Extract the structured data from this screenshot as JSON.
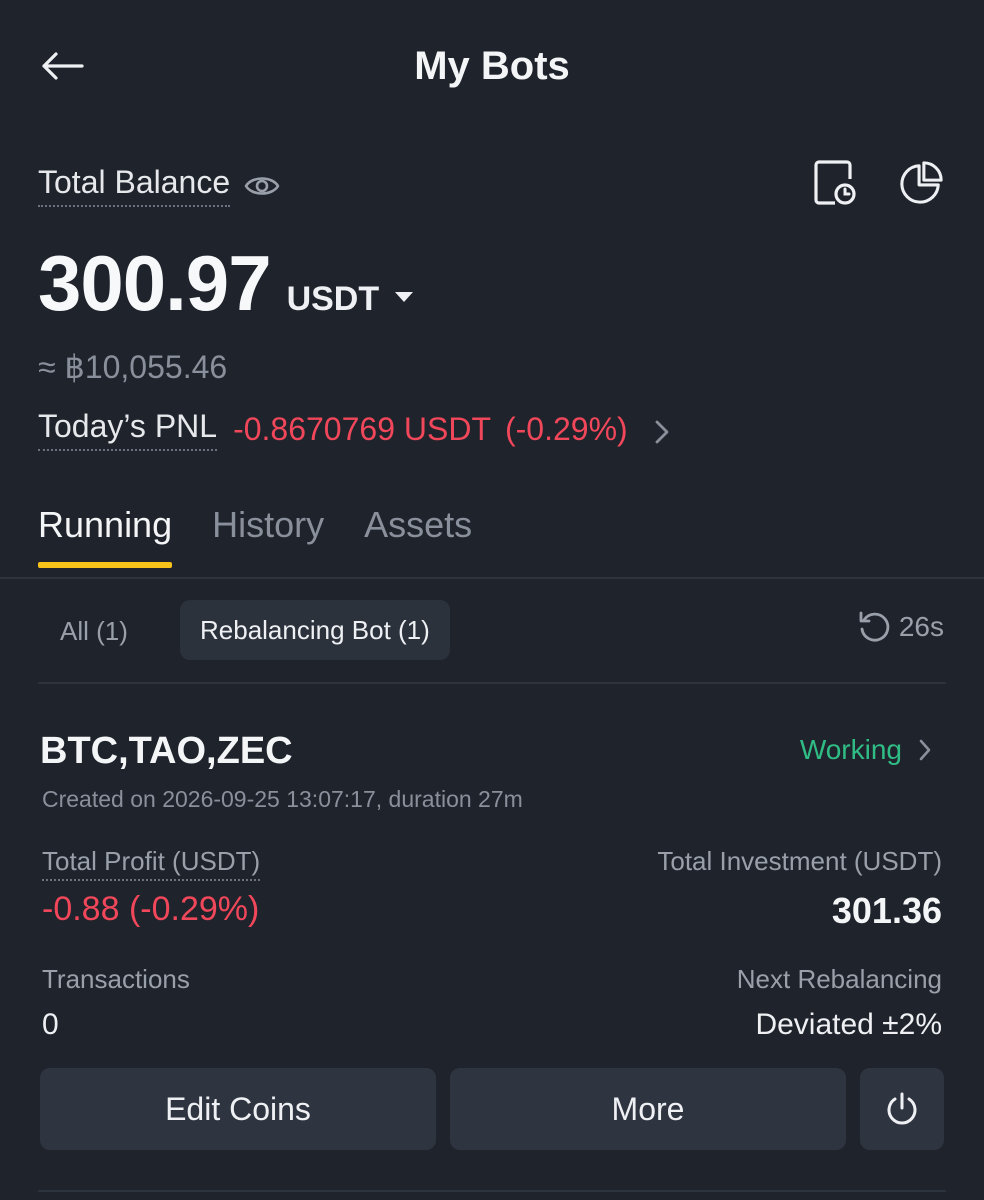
{
  "header": {
    "title": "My Bots",
    "back_icon": "arrow-left-icon"
  },
  "balance": {
    "label": "Total Balance",
    "value": "300.97",
    "unit": "USDT",
    "fiat_equiv": "≈ ฿10,055.46",
    "icons": [
      "eye-icon",
      "history-document-icon",
      "pie-chart-icon",
      "caret-down-icon"
    ]
  },
  "pnl": {
    "label": "Today’s PNL",
    "value": "-0.8670769 USDT",
    "percent": "(-0.29%)"
  },
  "tabs": [
    {
      "label": "Running",
      "active": true
    },
    {
      "label": "History",
      "active": false
    },
    {
      "label": "Assets",
      "active": false
    }
  ],
  "filters": {
    "all": "All (1)",
    "rebalancing": "Rebalancing Bot (1)",
    "refresh": "26s"
  },
  "bot": {
    "name": "BTC,TAO,ZEC",
    "status": "Working",
    "created": "Created on 2026-09-25 13:07:17, duration 27m",
    "profit_label": "Total Profit (USDT)",
    "profit_value": "-0.88 (-0.29%)",
    "investment_label": "Total Investment (USDT)",
    "investment_value": "301.36",
    "transactions_label": "Transactions",
    "transactions_value": "0",
    "next_rebalancing_label": "Next Rebalancing",
    "next_rebalancing_value": "Deviated ±2%",
    "edit_label": "Edit Coins",
    "more_label": "More"
  },
  "colors": {
    "background": "#1f232b",
    "negative": "#f0475a",
    "positive": "#2fbd85",
    "accent": "#f7c21a"
  }
}
